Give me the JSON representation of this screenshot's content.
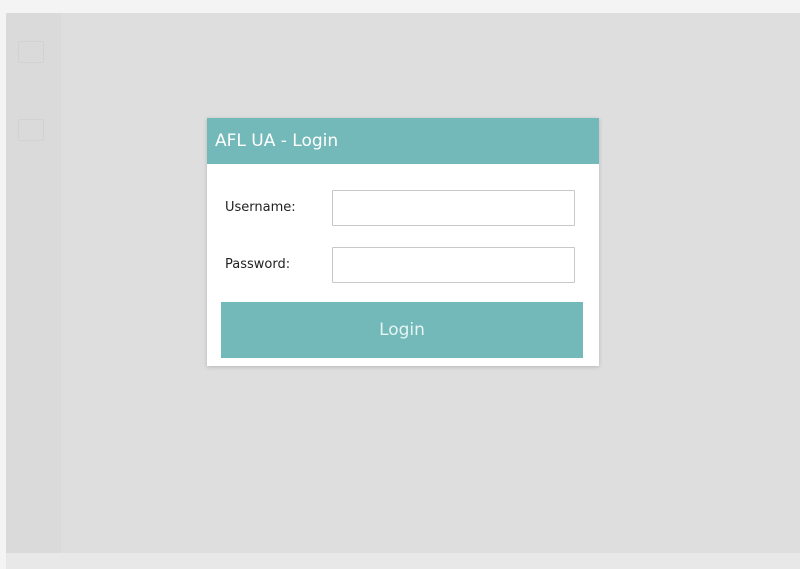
{
  "theme": {
    "accent": "#73b9b9"
  },
  "login": {
    "title": "AFL UA - Login",
    "username_label": "Username:",
    "username_value": "",
    "password_label": "Password:",
    "password_value": "",
    "button_label": "Login"
  }
}
